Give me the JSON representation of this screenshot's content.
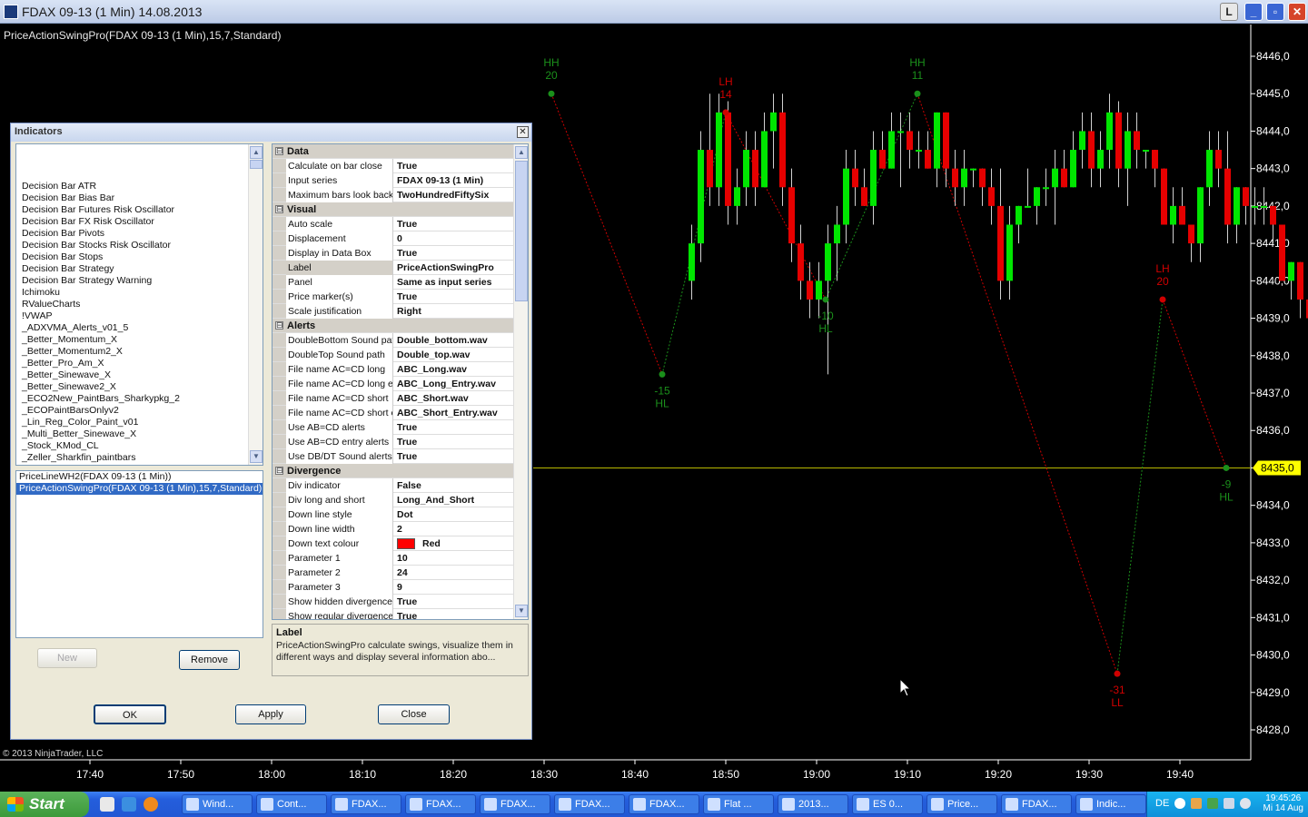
{
  "window": {
    "title": "FDAX 09-13 (1 Min)  14.08.2013",
    "btn_l": "L",
    "btn_min": "_",
    "btn_max": "▫",
    "btn_close": "✕"
  },
  "chart": {
    "indicator_label": "PriceActionSwingPro(FDAX 09-13 (1 Min),15,7,Standard)",
    "copyright": "© 2013 NinjaTrader, LLC",
    "current_price": "8435,0",
    "price_line": 8435.0,
    "colors": {
      "up": "#00e600",
      "down": "#e60000",
      "swing_up": "#1b8f1b",
      "swing_down": "#d00000",
      "price_line": "#b8b800",
      "axis_text": "#ffffff"
    }
  },
  "chart_data": {
    "type": "candlestick",
    "x_ticks": [
      "17:40",
      "17:50",
      "18:00",
      "18:10",
      "18:20",
      "18:30",
      "18:40",
      "18:50",
      "19:00",
      "19:10",
      "19:20",
      "19:30",
      "19:40"
    ],
    "y_ticks": [
      "8446,0",
      "8445,0",
      "8444,0",
      "8443,0",
      "8442,0",
      "8441,0",
      "8440,0",
      "8439,0",
      "8438,0",
      "8437,0",
      "8436,0",
      "8435,0",
      "8434,0",
      "8433,0",
      "8432,0",
      "8431,0",
      "8430,0",
      "8429,0",
      "8428,0"
    ],
    "ylim": [
      8427.5,
      8446.6
    ],
    "start_minute": 18.25,
    "candles": [
      [
        8440.0,
        8441.5,
        8439.5,
        8441.0
      ],
      [
        8441.0,
        8444.0,
        8440.5,
        8443.5
      ],
      [
        8443.5,
        8445.0,
        8442.0,
        8442.5
      ],
      [
        8442.5,
        8445.0,
        8442.0,
        8444.5
      ],
      [
        8444.5,
        8444.8,
        8441.5,
        8442.0
      ],
      [
        8442.0,
        8443.0,
        8441.5,
        8442.5
      ],
      [
        8442.5,
        8444.0,
        8442.0,
        8443.5
      ],
      [
        8443.5,
        8444.0,
        8442.0,
        8442.5
      ],
      [
        8442.5,
        8444.5,
        8442.5,
        8444.0
      ],
      [
        8444.0,
        8445.0,
        8443.0,
        8444.5
      ],
      [
        8444.5,
        8445.0,
        8442.0,
        8442.5
      ],
      [
        8442.5,
        8443.0,
        8440.5,
        8441.0
      ],
      [
        8441.0,
        8441.5,
        8439.5,
        8440.0
      ],
      [
        8440.0,
        8440.5,
        8439.0,
        8439.5
      ],
      [
        8439.5,
        8440.5,
        8439.0,
        8440.0
      ],
      [
        8440.0,
        8441.5,
        8437.5,
        8441.0
      ],
      [
        8441.0,
        8442.0,
        8440.0,
        8441.5
      ],
      [
        8441.5,
        8443.5,
        8441.0,
        8443.0
      ],
      [
        8443.0,
        8443.5,
        8442.0,
        8442.5
      ],
      [
        8442.5,
        8443.0,
        8442.0,
        8442.0
      ],
      [
        8442.0,
        8444.0,
        8441.5,
        8443.5
      ],
      [
        8443.5,
        8444.0,
        8443.0,
        8443.0
      ],
      [
        8443.0,
        8444.5,
        8443.0,
        8444.0
      ],
      [
        8444.0,
        8444.5,
        8442.5,
        8444.0
      ],
      [
        8444.0,
        8444.5,
        8443.0,
        8443.5
      ],
      [
        8443.5,
        8444.0,
        8443.0,
        8443.5
      ],
      [
        8443.5,
        8444.0,
        8443.0,
        8443.0
      ],
      [
        8443.0,
        8444.5,
        8442.5,
        8444.5
      ],
      [
        8444.5,
        8444.5,
        8442.5,
        8443.0
      ],
      [
        8443.0,
        8443.5,
        8442.0,
        8442.5
      ],
      [
        8442.5,
        8443.5,
        8442.0,
        8443.0
      ],
      [
        8443.0,
        8443.0,
        8442.5,
        8443.0
      ],
      [
        8443.0,
        8443.0,
        8442.0,
        8442.5
      ],
      [
        8442.5,
        8443.0,
        8441.5,
        8442.0
      ],
      [
        8442.0,
        8443.0,
        8439.5,
        8440.0
      ],
      [
        8440.0,
        8442.0,
        8439.5,
        8441.5
      ],
      [
        8441.5,
        8442.0,
        8441.0,
        8442.0
      ],
      [
        8442.0,
        8443.0,
        8442.0,
        8442.0
      ],
      [
        8442.0,
        8442.5,
        8441.5,
        8442.5
      ],
      [
        8442.5,
        8443.0,
        8442.0,
        8442.5
      ],
      [
        8442.5,
        8443.5,
        8441.5,
        8443.0
      ],
      [
        8443.0,
        8443.5,
        8442.5,
        8442.5
      ],
      [
        8442.5,
        8444.0,
        8442.5,
        8443.5
      ],
      [
        8443.5,
        8444.5,
        8443.0,
        8444.0
      ],
      [
        8444.0,
        8444.5,
        8442.5,
        8443.0
      ],
      [
        8443.0,
        8444.0,
        8442.5,
        8443.5
      ],
      [
        8443.5,
        8445.0,
        8443.0,
        8444.5
      ],
      [
        8444.5,
        8444.8,
        8442.5,
        8443.0
      ],
      [
        8443.0,
        8444.5,
        8442.0,
        8444.0
      ],
      [
        8444.0,
        8444.5,
        8443.0,
        8443.5
      ],
      [
        8443.5,
        8443.5,
        8443.0,
        8443.5
      ],
      [
        8443.5,
        8443.5,
        8442.5,
        8443.0
      ],
      [
        8443.0,
        8443.0,
        8441.5,
        8441.5
      ],
      [
        8441.5,
        8442.5,
        8441.0,
        8442.0
      ],
      [
        8442.0,
        8442.5,
        8441.5,
        8441.5
      ],
      [
        8441.5,
        8441.5,
        8440.5,
        8441.0
      ],
      [
        8441.0,
        8442.5,
        8440.5,
        8442.5
      ],
      [
        8442.5,
        8444.0,
        8442.0,
        8443.5
      ],
      [
        8443.5,
        8444.0,
        8442.5,
        8443.0
      ],
      [
        8443.0,
        8444.0,
        8441.0,
        8441.5
      ],
      [
        8441.5,
        8442.5,
        8441.0,
        8442.5
      ],
      [
        8442.5,
        8442.5,
        8441.5,
        8442.0
      ],
      [
        8442.0,
        8442.5,
        8441.5,
        8442.0
      ],
      [
        8442.0,
        8442.5,
        8441.5,
        8442.0
      ],
      [
        8442.0,
        8442.0,
        8441.0,
        8441.5
      ],
      [
        8441.5,
        8441.5,
        8440.0,
        8440.0
      ],
      [
        8440.0,
        8440.5,
        8439.5,
        8440.5
      ],
      [
        8440.5,
        8440.5,
        8439.0,
        8439.5
      ],
      [
        8439.5,
        8439.5,
        8438.5,
        8439.0
      ],
      [
        8439.0,
        8439.0,
        8434.5,
        8434.5
      ],
      [
        8434.5,
        8434.5,
        8429.5,
        8431.0
      ],
      [
        8431.0,
        8433.5,
        8429.5,
        8433.0
      ],
      [
        8433.0,
        8434.0,
        8430.0,
        8430.5
      ],
      [
        8430.5,
        8434.0,
        8430.0,
        8432.0
      ],
      [
        8432.0,
        8433.0,
        8431.5,
        8432.5
      ],
      [
        8432.5,
        8433.5,
        8431.5,
        8433.0
      ],
      [
        8433.0,
        8433.5,
        8432.0,
        8433.5
      ],
      [
        8433.5,
        8435.5,
        8433.0,
        8435.0
      ],
      [
        8435.0,
        8437.5,
        8434.5,
        8437.0
      ],
      [
        8437.0,
        8439.5,
        8436.5,
        8439.0
      ],
      [
        8439.0,
        8439.5,
        8438.0,
        8438.5
      ],
      [
        8438.5,
        8439.0,
        8437.5,
        8437.5
      ],
      [
        8437.5,
        8438.0,
        8437.0,
        8437.5
      ],
      [
        8437.5,
        8438.5,
        8437.0,
        8438.0
      ],
      [
        8438.0,
        8438.5,
        8437.5,
        8437.5
      ],
      [
        8437.5,
        8437.5,
        8436.5,
        8437.0
      ],
      [
        8437.0,
        8437.5,
        8434.5,
        8435.0
      ]
    ],
    "swings": [
      {
        "minute": 30.8,
        "price": 8445.0,
        "kind": "high",
        "label_top": "HH",
        "label_num": "20",
        "color": "#1b8f1b"
      },
      {
        "minute": 43.0,
        "price": 8437.5,
        "kind": "low",
        "label_top": "-15",
        "label_num": "HL",
        "color": "#1b8f1b"
      },
      {
        "minute": 50.0,
        "price": 8444.5,
        "kind": "high",
        "label_top": "LH",
        "label_num": "14",
        "color": "#d00000"
      },
      {
        "minute": 61.0,
        "price": 8439.5,
        "kind": "low",
        "label_top": "-10",
        "label_num": "HL",
        "color": "#1b8f1b"
      },
      {
        "minute": 71.1,
        "price": 8445.0,
        "kind": "high",
        "label_top": "HH",
        "label_num": "11",
        "color": "#1b8f1b"
      },
      {
        "minute": 93.1,
        "price": 8429.5,
        "kind": "low",
        "label_top": "-31",
        "label_num": "LL",
        "color": "#d00000"
      },
      {
        "minute": 98.1,
        "price": 8439.5,
        "kind": "high",
        "label_top": "LH",
        "label_num": "20",
        "color": "#d00000"
      },
      {
        "minute": 105.1,
        "price": 8435.0,
        "kind": "low",
        "label_top": "-9",
        "label_num": "HL",
        "color": "#1b8f1b"
      }
    ]
  },
  "dialog": {
    "title": "Indicators",
    "close": "✕",
    "indicator_list": [
      "Decision Bar ATR",
      "Decision Bar Bias Bar",
      "Decision Bar Futures Risk Oscillator",
      "Decision Bar FX Risk Oscillator",
      "Decision Bar Pivots",
      "Decision Bar Stocks Risk Oscillator",
      "Decision Bar Stops",
      "Decision Bar Strategy",
      "Decision Bar Strategy Warning",
      "Ichimoku",
      "RValueCharts",
      "!VWAP",
      "_ADXVMA_Alerts_v01_5",
      "_Better_Momentum_X",
      "_Better_Momentum2_X",
      "_Better_Pro_Am_X",
      "_Better_Sinewave_X",
      "_Better_Sinewave2_X",
      "_ECO2New_PaintBars_Sharkypkg_2",
      "_ECOPaintBarsOnlyv2",
      "_Lin_Reg_Color_Paint_v01",
      "_Multi_Better_Sinewave_X",
      "_Stock_KMod_CL",
      "_Zeller_Sharkfin_paintbars"
    ],
    "applied": [
      "PriceLineWH2(FDAX 09-13 (1 Min))",
      "PriceActionSwingPro(FDAX 09-13 (1 Min),15,7,Standard)"
    ],
    "buttons": {
      "new": "New",
      "remove": "Remove",
      "ok": "OK",
      "apply": "Apply",
      "close": "Close"
    },
    "expander": "⊟",
    "properties": [
      {
        "category": "Data"
      },
      {
        "name": "Calculate on bar close",
        "value": "True"
      },
      {
        "name": "Input series",
        "value": "FDAX 09-13 (1 Min)"
      },
      {
        "name": "Maximum bars look back",
        "value": "TwoHundredFiftySix"
      },
      {
        "category": "Visual"
      },
      {
        "name": "Auto scale",
        "value": "True"
      },
      {
        "name": "Displacement",
        "value": "0"
      },
      {
        "name": "Display in Data Box",
        "value": "True"
      },
      {
        "name": "Label",
        "value": "PriceActionSwingPro",
        "highlight": true
      },
      {
        "name": "Panel",
        "value": "Same as input series"
      },
      {
        "name": "Price marker(s)",
        "value": "True"
      },
      {
        "name": "Scale justification",
        "value": "Right"
      },
      {
        "category": "Alerts"
      },
      {
        "name": "DoubleBottom Sound path",
        "value": "Double_bottom.wav"
      },
      {
        "name": "DoubleTop Sound path",
        "value": "Double_top.wav"
      },
      {
        "name": "File name AC=CD long",
        "value": "ABC_Long.wav"
      },
      {
        "name": "File name AC=CD long entry",
        "value": "ABC_Long_Entry.wav"
      },
      {
        "name": "File name AC=CD short",
        "value": "ABC_Short.wav"
      },
      {
        "name": "File name AC=CD short entry",
        "value": "ABC_Short_Entry.wav"
      },
      {
        "name": "Use AB=CD alerts",
        "value": "True"
      },
      {
        "name": "Use AB=CD entry alerts",
        "value": "True"
      },
      {
        "name": "Use DB/DT Sound alerts",
        "value": "True"
      },
      {
        "category": "Divergence"
      },
      {
        "name": "Div indicator",
        "value": "False"
      },
      {
        "name": "Div long and short",
        "value": "Long_And_Short"
      },
      {
        "name": "Down line style",
        "value": "Dot"
      },
      {
        "name": "Down line width",
        "value": "2"
      },
      {
        "name": "Down text colour",
        "value": "Red",
        "swatch": "#ff0000"
      },
      {
        "name": "Parameter 1",
        "value": "10"
      },
      {
        "name": "Parameter 2",
        "value": "24"
      },
      {
        "name": "Parameter 3",
        "value": "9"
      },
      {
        "name": "Show hidden divergence",
        "value": "True"
      },
      {
        "name": "Show regular divergence",
        "value": "True"
      }
    ],
    "description": {
      "title": "Label",
      "text": "PriceActionSwingPro calculate swings, visualize them in different ways and display several information abo..."
    }
  },
  "taskbar": {
    "start": "Start",
    "tasks": [
      "Wind...",
      "Cont...",
      "FDAX...",
      "FDAX...",
      "FDAX...",
      "FDAX...",
      "FDAX...",
      "Flat ...",
      "2013...",
      "ES 0...",
      "Price...",
      "FDAX...",
      "Indic..."
    ],
    "lang": "DE",
    "time": "19:45:26",
    "date": "Mi 14 Aug"
  }
}
